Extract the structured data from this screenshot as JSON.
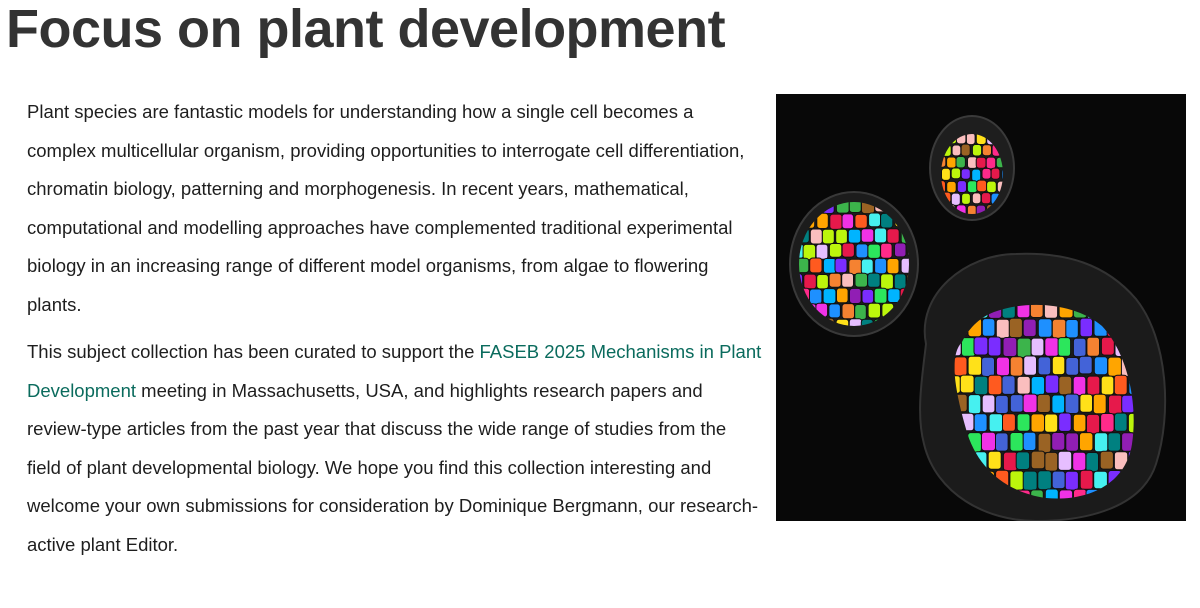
{
  "page": {
    "title": "Focus on plant development"
  },
  "intro": {
    "paragraph1": "Plant species are fantastic models for understanding how a single cell becomes a complex multicellular organism, providing opportunities to interrogate cell differentiation, chromatin biology, patterning and morphogenesis. In recent years, mathematical, computational and modelling approaches have complemented traditional experimental biology in an increasing range of different model organisms, from algae to flowering plants.",
    "paragraph2_before": "This subject collection has been curated to support the ",
    "paragraph2_link": "FASEB 2025 Mechanisms in Plant Development",
    "paragraph2_after": " meeting in Massachusetts, USA, and highlights research papers and review-type articles from the past year that discuss the wide range of studies from the field of plant developmental biology. We hope you find this collection interesting and welcome your own submissions for consideration by Dominique Bergmann, our research-active plant Editor."
  },
  "figure": {
    "palette": [
      "#e6194b",
      "#3cb44b",
      "#ffe119",
      "#4363d8",
      "#f58231",
      "#911eb4",
      "#46f0f0",
      "#f032e6",
      "#bcf60c",
      "#fabebe",
      "#008080",
      "#e6beff",
      "#9a6324",
      "#ff5a1f",
      "#00b4ff",
      "#7a2dff",
      "#2ce65c",
      "#ff2a8a",
      "#1e90ff",
      "#ffa500"
    ]
  }
}
